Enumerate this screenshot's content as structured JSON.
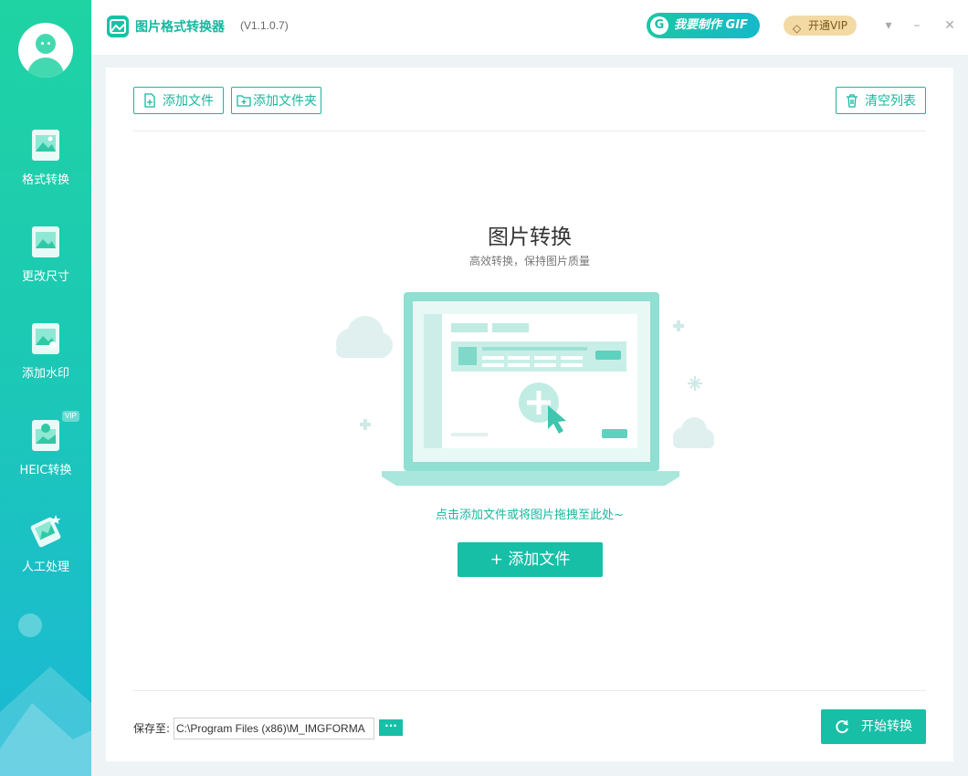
{
  "sidebar": {
    "items": [
      {
        "label": "格式转换",
        "icon": "image-convert-icon"
      },
      {
        "label": "更改尺寸",
        "icon": "image-resize-icon"
      },
      {
        "label": "添加水印",
        "icon": "image-watermark-icon"
      },
      {
        "label": "HEIC转换",
        "icon": "apple-image-icon",
        "badge": "VIP"
      },
      {
        "label": "人工处理",
        "icon": "manual-edit-icon"
      }
    ]
  },
  "titlebar": {
    "app_title": "图片格式转换器",
    "version": "(V1.1.0.7)",
    "gif_button": "我要制作 GIF",
    "vip_button": "开通VIP"
  },
  "toolbar": {
    "add_file": "添加文件",
    "add_folder": "添加文件夹",
    "clear_list": "清空列表"
  },
  "empty_state": {
    "title": "图片转换",
    "subtitle": "高效转换，保持图片质量",
    "hint": "点击添加文件或将图片拖拽至此处~",
    "add_button": "+ 添加文件"
  },
  "footer": {
    "save_label": "保存至:",
    "save_path": "C:\\Program Files (x86)\\M_IMGFORMA",
    "browse_label": "···",
    "start_button": "开始转换"
  },
  "colors": {
    "accent": "#17bfa7",
    "sidebar_top": "#1fd3a3",
    "sidebar_bottom": "#1ab8d6",
    "vip": "#f3d9a4"
  }
}
